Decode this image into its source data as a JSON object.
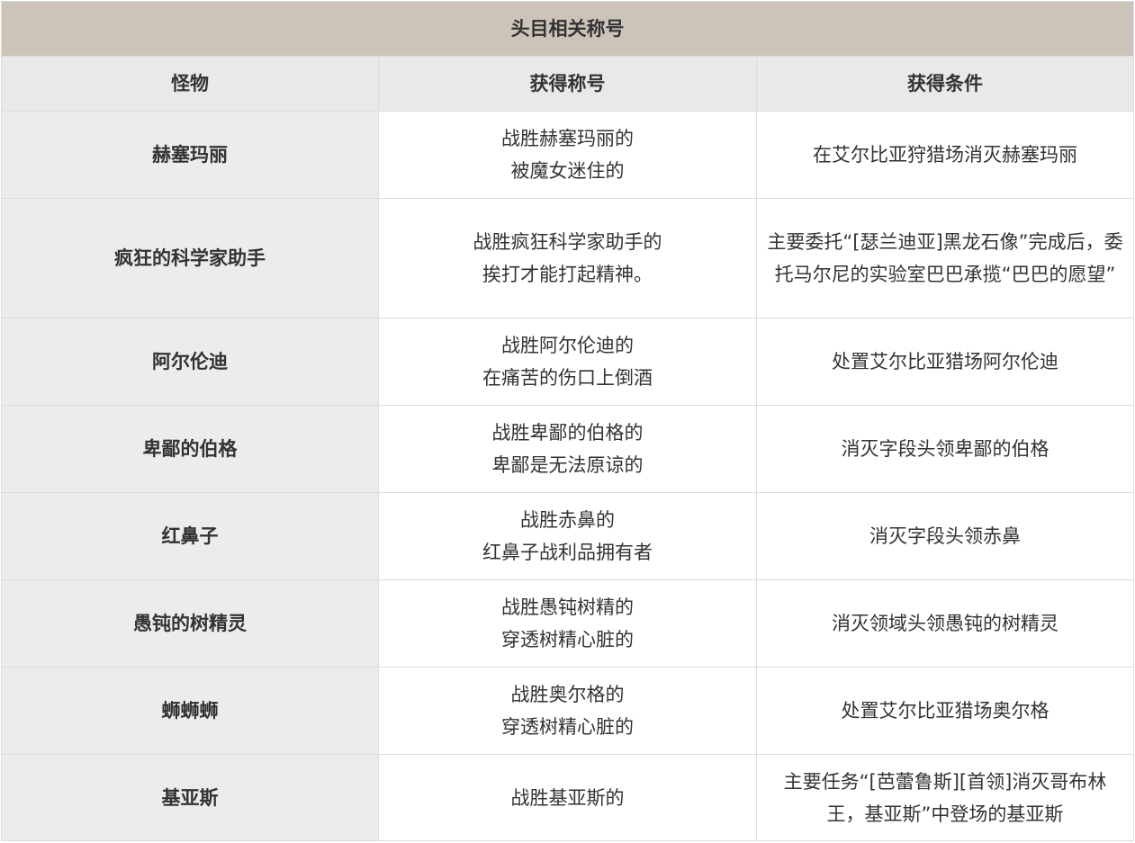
{
  "table": {
    "title": "头目相关称号",
    "headers": [
      "怪物",
      "获得称号",
      "获得条件"
    ],
    "rows": [
      {
        "monster": "赫塞玛丽",
        "title_lines": [
          "战胜赫塞玛丽的",
          "被魔女迷住的"
        ],
        "condition": "在艾尔比亚狩猎场消灭赫塞玛丽"
      },
      {
        "monster": "疯狂的科学家助手",
        "title_lines": [
          "战胜疯狂科学家助手的",
          "挨打才能打起精神。"
        ],
        "condition": "主要委托“[瑟兰迪亚]黑龙石像”完成后，委托马尔尼的实验室巴巴承揽“巴巴的愿望”"
      },
      {
        "monster": "阿尔伦迪",
        "title_lines": [
          "战胜阿尔伦迪的",
          "在痛苦的伤口上倒酒"
        ],
        "condition": "处置艾尔比亚猎场阿尔伦迪"
      },
      {
        "monster": "卑鄙的伯格",
        "title_lines": [
          "战胜卑鄙的伯格的",
          "卑鄙是无法原谅的"
        ],
        "condition": "消灭字段头领卑鄙的伯格"
      },
      {
        "monster": "红鼻子",
        "title_lines": [
          "战胜赤鼻的",
          "红鼻子战利品拥有者"
        ],
        "condition": "消灭字段头领赤鼻"
      },
      {
        "monster": "愚钝的树精灵",
        "title_lines": [
          "战胜愚钝树精的",
          "穿透树精心脏的"
        ],
        "condition": "消灭领域头领愚钝的树精灵"
      },
      {
        "monster": "蛳蛳蛳",
        "title_lines": [
          "战胜奥尔格的",
          "穿透树精心脏的"
        ],
        "condition": "处置艾尔比亚猎场奥尔格"
      },
      {
        "monster": "基亚斯",
        "title_lines": [
          "战胜基亚斯的",
          ""
        ],
        "condition": "主要任务“[芭蕾鲁斯][首领]消灭哥布林王，基亚斯”中登场的基亚斯"
      }
    ]
  }
}
